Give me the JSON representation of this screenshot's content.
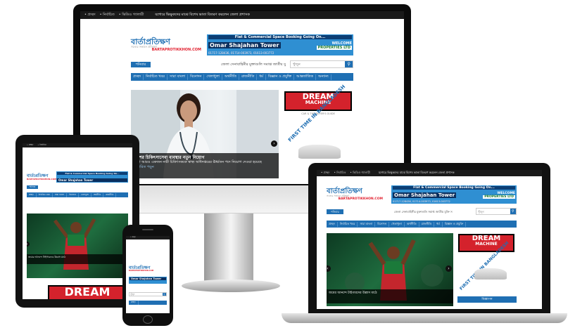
{
  "topbar": {
    "items": [
      "• প্রচ্ছদ",
      "• নির্বাচিত",
      "• ভিডিও গ্যালারী"
    ],
    "headline": "যশোরে ভিক্ষুকদের মাঝে বিশেষ ভাতা বিতরণ করলেন জেলা প্রশাসক"
  },
  "logo": {
    "name": "বার্তাপ্রতিক্ষণ",
    "tagline": "সত্যের সন্ধানে প্রতিক্ষণ",
    "url": "BARTAPROTIKKHON.COM"
  },
  "ad": {
    "line1": "Flat & Commercial Space Booking Going On...",
    "tower": "Omar Shajahan Tower",
    "welcome": "WELCOME",
    "properties": "PROPERTIES LTD",
    "phone": "01717-128436, 01714-003973, 01613-003772"
  },
  "date_label": "শনিবার",
  "ticker": "জেলা সেনাবাহিনীর মুক্তাগুলি সমাপ্ত জাতীয় যুক্তি স",
  "search": {
    "placeholder": "খুঁজুন",
    "icon": "search-icon"
  },
  "nav": [
    "প্রচ্ছদ",
    "নির্বাচিত খবর",
    "সারা বাংলা",
    "বিনোদন",
    "খেলাধুলা",
    "অর্থনীতি",
    "রাজনীতি",
    "ধর্ম",
    "বিজ্ঞান ও প্রযুক্তি",
    "আন্তর্জাতিক",
    "অন্যান্য"
  ],
  "slide": {
    "title": "দেশের চিকিৎসাসেবা ব্যবস্থার নতুন নিয়োগ",
    "text": "দেশে আরও একজন নারী চিকিৎসককে স্বাস্থ্য অধিদপ্তরের ঊর্ধ্বতন পদে নিয়োগ দেওয়া হয়েছে",
    "more": "বিস্তারিত পড়ুন"
  },
  "sports_slide": {
    "title": "জয়ের আনন্দে টাইগারদের উল্লাস মাঠে"
  },
  "dream_ad": {
    "title": "DREAM",
    "title2": "MACHINE",
    "subtitle": "CAR & THE BUYER'S GUIDE",
    "first_time": "FIRST TIME IN BANGLADESH"
  },
  "ad_button": "বিজ্ঞাপন",
  "colors": {
    "brand": "#1f6fb3",
    "accent": "#d4222c",
    "bar": "#1a1a1a"
  }
}
